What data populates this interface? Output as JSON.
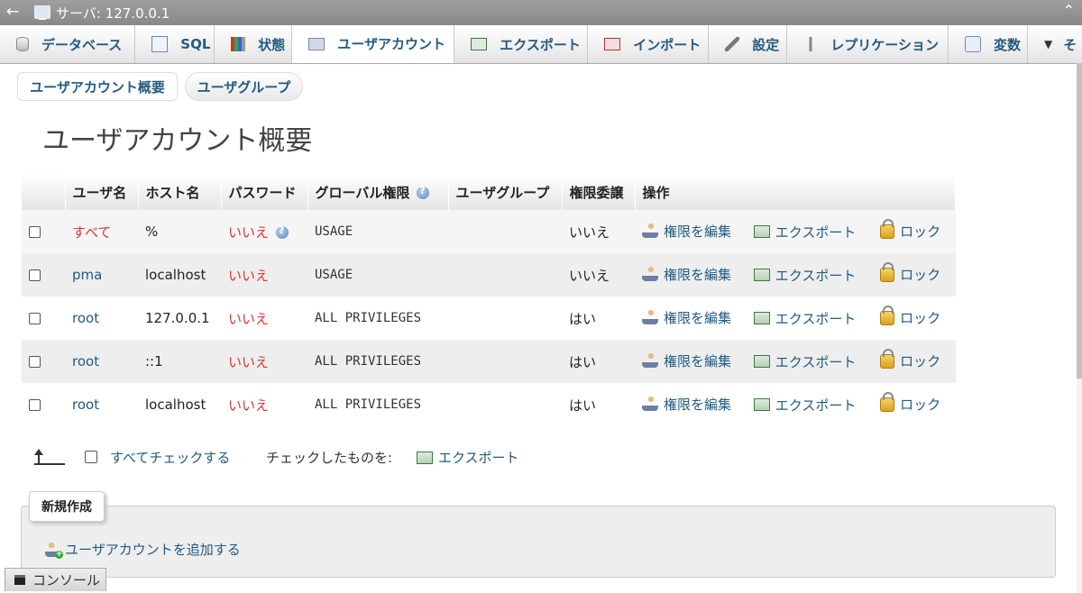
{
  "titlebar": {
    "title": "サーバ: 127.0.0.1",
    "back_icon": "←",
    "collapse_icon": "⌃"
  },
  "tabs": [
    {
      "label": "データベース",
      "icon": "database-icon"
    },
    {
      "label": "SQL",
      "icon": "sql-icon"
    },
    {
      "label": "状態",
      "icon": "status-icon"
    },
    {
      "label": "ユーザアカウント",
      "icon": "user-accounts-icon",
      "active": true
    },
    {
      "label": "エクスポート",
      "icon": "export-icon"
    },
    {
      "label": "インポート",
      "icon": "import-icon"
    },
    {
      "label": "設定",
      "icon": "settings-icon"
    },
    {
      "label": "レプリケーション",
      "icon": "replication-icon"
    },
    {
      "label": "変数",
      "icon": "variables-icon"
    },
    {
      "label": "そ",
      "icon": "more-caret-icon"
    }
  ],
  "subtabs": {
    "overview": "ユーザアカウント概要",
    "usergroups": "ユーザグループ"
  },
  "page": {
    "title": "ユーザアカウント概要"
  },
  "table": {
    "headers": {
      "user": "ユーザ名",
      "host": "ホスト名",
      "password": "パスワード",
      "global": "グローバル権限",
      "usergroup": "ユーザグループ",
      "grant": "権限委譲",
      "action": "操作"
    },
    "rows": [
      {
        "user": "すべて",
        "host": "%",
        "password": "いいえ",
        "global": "USAGE",
        "usergroup": "",
        "grant": "いいえ"
      },
      {
        "user": "pma",
        "host": "localhost",
        "password": "いいえ",
        "global": "USAGE",
        "usergroup": "",
        "grant": "いいえ"
      },
      {
        "user": "root",
        "host": "127.0.0.1",
        "password": "いいえ",
        "global": "ALL PRIVILEGES",
        "usergroup": "",
        "grant": "はい"
      },
      {
        "user": "root",
        "host": "::1",
        "password": "いいえ",
        "global": "ALL PRIVILEGES",
        "usergroup": "",
        "grant": "はい"
      },
      {
        "user": "root",
        "host": "localhost",
        "password": "いいえ",
        "global": "ALL PRIVILEGES",
        "usergroup": "",
        "grant": "はい"
      }
    ],
    "actions": {
      "edit": "権限を編集",
      "export": "エクスポート",
      "lock": "ロック"
    }
  },
  "bulk": {
    "check_all": "すべてチェックする",
    "with_selected": "チェックしたものを:",
    "export": "エクスポート"
  },
  "new_section": {
    "legend": "新規作成",
    "add_user": "ユーザアカウントを追加する"
  },
  "console": {
    "label": "コンソール"
  },
  "colors": {
    "link": "#235a81",
    "no_password": "#dd3333"
  }
}
